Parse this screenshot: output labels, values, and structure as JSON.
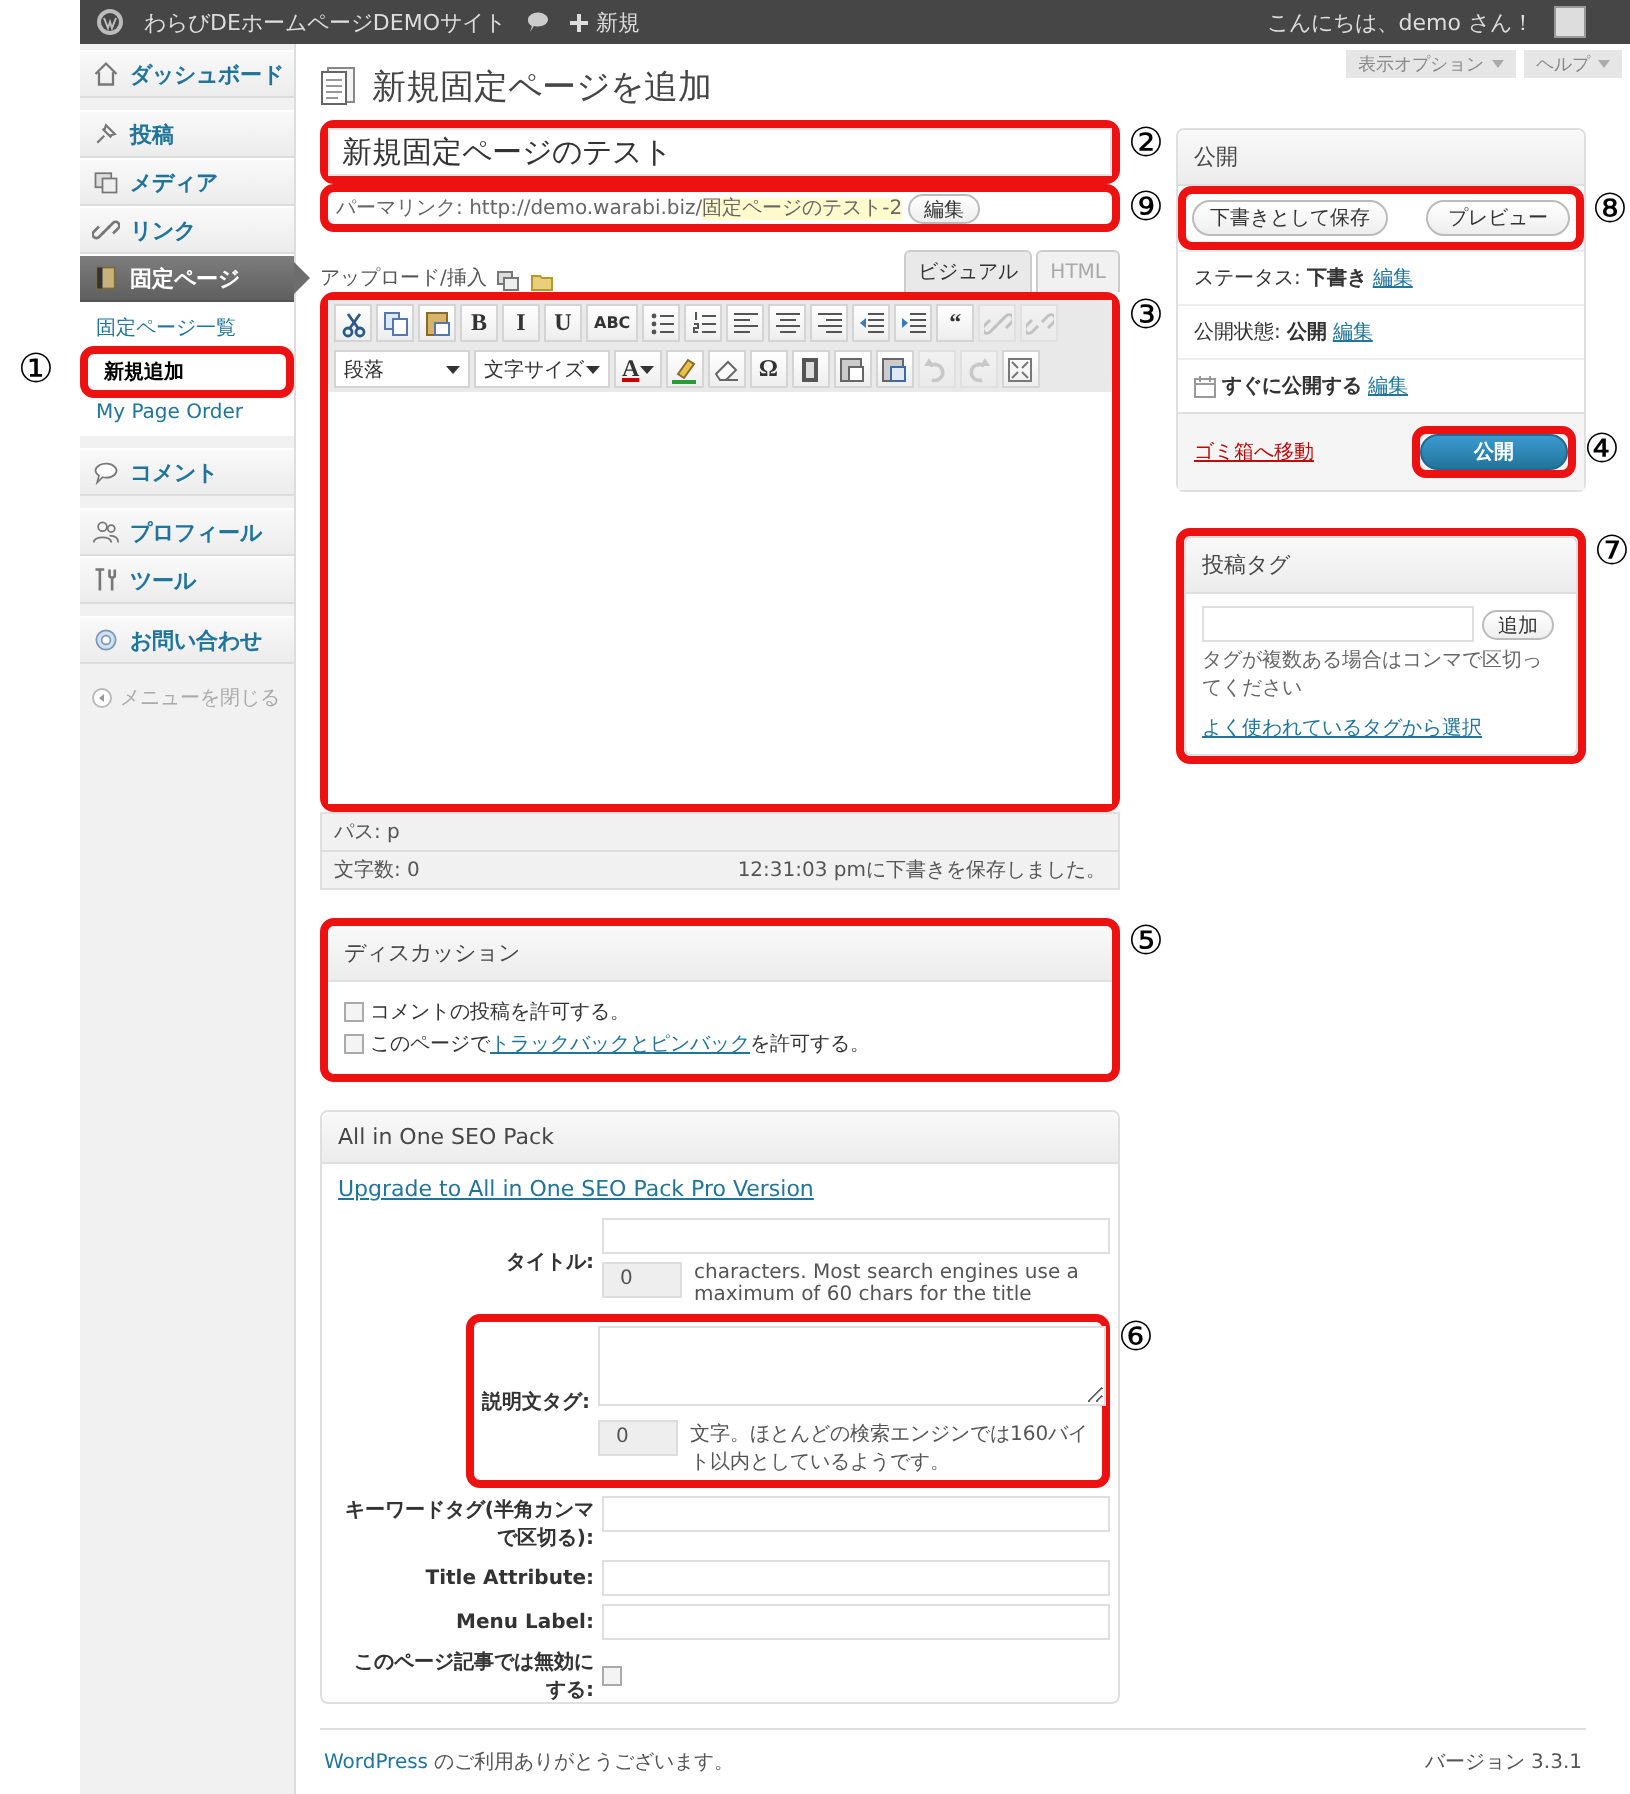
{
  "admin_bar": {
    "site_name": "わらびDEホームページDEMOサイト",
    "new_label": "新規",
    "greeting": "こんにちは、demo さん！"
  },
  "sidebar": {
    "groups": [
      [
        {
          "label": "ダッシュボード",
          "kind": "dashboard",
          "selected": false
        }
      ],
      [
        {
          "label": "投稿",
          "kind": "posts",
          "selected": false
        },
        {
          "label": "メディア",
          "kind": "media",
          "selected": false
        },
        {
          "label": "リンク",
          "kind": "links",
          "selected": false
        },
        {
          "label": "固定ページ",
          "kind": "pages",
          "selected": true,
          "children": [
            {
              "label": "固定ページ一覧",
              "selected": false
            },
            {
              "label": "新規追加",
              "selected": true,
              "callout": {
                "mark": "①"
              }
            },
            {
              "label": "My Page Order",
              "selected": false
            }
          ]
        }
      ],
      [
        {
          "label": "コメント",
          "kind": "comments",
          "selected": false
        }
      ],
      [
        {
          "label": "プロフィール",
          "kind": "profile",
          "selected": false
        },
        {
          "label": "ツール",
          "kind": "tools",
          "selected": false
        }
      ],
      [
        {
          "label": "お問い合わせ",
          "kind": "contact",
          "selected": false
        }
      ]
    ],
    "collapse_label": "メニューを閉じる"
  },
  "page_title": "新規固定ページを追加",
  "title_field": {
    "value": "新規固定ページのテスト",
    "callout": {
      "mark": "②"
    }
  },
  "permalink": {
    "label": "パーマリンク:",
    "base": "http://demo.warabi.biz/",
    "slug": "固定ページのテスト-2",
    "button": "編集",
    "callout": {
      "mark": "⑨"
    }
  },
  "editor": {
    "upload_label": "アップロード/挿入",
    "tabs": [
      {
        "label": "ビジュアル",
        "selected": true
      },
      {
        "label": "HTML",
        "selected": false
      }
    ],
    "toolbar_rows": [
      [
        {
          "kind": "cut"
        },
        {
          "kind": "copy"
        },
        {
          "kind": "paste"
        },
        {
          "kind": "text",
          "text": "B"
        },
        {
          "kind": "text",
          "text": "I"
        },
        {
          "kind": "text",
          "text": "U"
        },
        {
          "kind": "text",
          "text": "ABC"
        },
        {
          "kind": "bullets"
        },
        {
          "kind": "numbers"
        },
        {
          "kind": "align-left"
        },
        {
          "kind": "align-center"
        },
        {
          "kind": "align-right"
        },
        {
          "kind": "outdent"
        },
        {
          "kind": "indent"
        },
        {
          "kind": "text",
          "text": "“"
        },
        {
          "kind": "link",
          "disabled": true
        },
        {
          "kind": "unlink",
          "disabled": true
        }
      ],
      [
        {
          "kind": "select",
          "text": "段落"
        },
        {
          "kind": "select",
          "text": "文字サイズ"
        },
        {
          "kind": "color",
          "text": "A"
        },
        {
          "kind": "highlight"
        },
        {
          "kind": "eraser"
        },
        {
          "kind": "text",
          "text": "Ω"
        },
        {
          "kind": "media"
        },
        {
          "kind": "pastetext"
        },
        {
          "kind": "pasteword"
        },
        {
          "kind": "undo",
          "disabled": true
        },
        {
          "kind": "redo",
          "disabled": true
        },
        {
          "kind": "fullscreen"
        }
      ]
    ],
    "path": "パス: p",
    "word_count": "文字数: 0",
    "saved_note": "12:31:03 pmに下書きを保存しました。",
    "callout": {
      "mark": "③"
    }
  },
  "discussion": {
    "title": "ディスカッション",
    "options": [
      {
        "before": "コメントの投稿を許可する。",
        "checked": false
      },
      {
        "before": "このページで",
        "link": "トラックバックとピンバック",
        "after": "を許可する。",
        "checked": false
      }
    ],
    "callout": {
      "mark": "⑤"
    }
  },
  "seo": {
    "title": "All in One SEO Pack",
    "upgrade_link": "Upgrade to All in One SEO Pack Pro Version",
    "fields": [
      {
        "kind": "title",
        "label": "タイトル:",
        "count": "0",
        "note": "characters. Most search engines use a maximum of 60 chars for the title"
      },
      {
        "kind": "description",
        "label": "説明文タグ:",
        "count": "0",
        "note": "文字。ほとんどの検索エンジンでは160バイト以内としているようです。",
        "callout": {
          "mark": "⑥"
        }
      },
      {
        "kind": "text",
        "label": "キーワードタグ(半角カンマで区切る):"
      },
      {
        "kind": "text",
        "label": "Title Attribute:"
      },
      {
        "kind": "text",
        "label": "Menu Label:"
      },
      {
        "kind": "checkbox",
        "label": "このページ記事では無効にする:",
        "checked": false
      }
    ]
  },
  "screen_options": [
    {
      "label": "表示オプション"
    },
    {
      "label": "ヘルプ"
    }
  ],
  "publish": {
    "title": "公開",
    "save_draft": "下書きとして保存",
    "preview": "プレビュー",
    "buttons_callout": {
      "mark": "⑧"
    },
    "rows": [
      {
        "kind": "status",
        "label": "ステータス:",
        "value": "下書き",
        "link": "編集"
      },
      {
        "kind": "status",
        "label": "公開状態:",
        "value": "公開",
        "link": "編集"
      },
      {
        "kind": "schedule",
        "value": "すぐに公開する",
        "link": "編集"
      }
    ],
    "trash": "ゴミ箱へ移動",
    "publish_button": "公開",
    "publish_callout": {
      "mark": "④"
    }
  },
  "tags": {
    "title": "投稿タグ",
    "add_button": "追加",
    "hint": "タグが複数ある場合はコンマで区切ってください",
    "link": "よく使われているタグから選択",
    "callout": {
      "mark": "⑦"
    }
  },
  "footer": {
    "link": "WordPress",
    "text": "のご利用ありがとうございます。",
    "version": "バージョン 3.3.1"
  }
}
